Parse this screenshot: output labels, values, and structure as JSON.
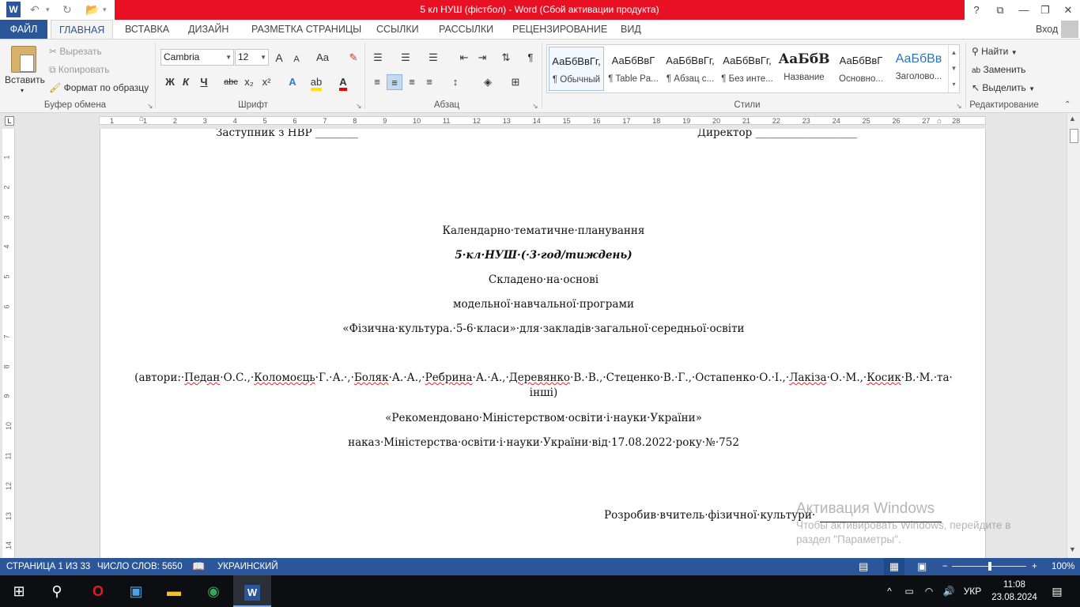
{
  "window": {
    "title": "5 кл НУШ (фістбол) -  Word (Сбой активации продукта)",
    "controls": {
      "help": "?",
      "ribbon_options": "⧉",
      "minimize": "—",
      "restore": "❐",
      "close": "✕"
    }
  },
  "qat": {
    "word_icon": "W",
    "undo": "↶",
    "redo": "↻",
    "open": "📂"
  },
  "tabs": [
    "ФАЙЛ",
    "ГЛАВНАЯ",
    "ВСТАВКА",
    "ДИЗАЙН",
    "РАЗМЕТКА СТРАНИЦЫ",
    "ССЫЛКИ",
    "РАССЫЛКИ",
    "РЕЦЕНЗИРОВАНИЕ",
    "ВИД"
  ],
  "signin": "Вход",
  "ribbon": {
    "clipboard": {
      "paste": "Вставить",
      "cut": "Вырезать",
      "copy": "Копировать",
      "format_painter": "Формат по образцу",
      "label": "Буфер обмена"
    },
    "font": {
      "font_name": "Cambria",
      "font_size": "12",
      "grow": "A",
      "shrink": "A",
      "case": "Aa",
      "bold": "Ж",
      "italic": "К",
      "underline": "Ч",
      "strike": "abc",
      "subscript": "x₂",
      "superscript": "x²",
      "label": "Шрифт"
    },
    "paragraph": {
      "label": "Абзац"
    },
    "styles": {
      "items": [
        {
          "sample": "АаБбВвГг,",
          "name": "¶ Обычный"
        },
        {
          "sample": "АаБбВвГ",
          "name": "¶ Table Pa..."
        },
        {
          "sample": "АаБбВвГг,",
          "name": "¶ Абзац с..."
        },
        {
          "sample": "АаБбВвГг,",
          "name": "¶ Без инте..."
        },
        {
          "sample": "АаБбВ",
          "name": "Название"
        },
        {
          "sample": "АаБбВвГ",
          "name": "Основно..."
        },
        {
          "sample": "АаБбВв",
          "name": "Заголово..."
        }
      ],
      "label": "Стили"
    },
    "editing": {
      "find": "Найти",
      "replace": "Заменить",
      "select": "Выделить",
      "label": "Редактирование"
    }
  },
  "ruler": {
    "numbers": [
      "1",
      "1",
      "2",
      "3",
      "4",
      "5",
      "6",
      "7",
      "8",
      "9",
      "10",
      "11",
      "12",
      "13",
      "14",
      "15",
      "16",
      "17",
      "18",
      "19",
      "20",
      "21",
      "22",
      "23",
      "24",
      "25",
      "26",
      "27",
      "28"
    ],
    "vnumbers": [
      "1",
      "2",
      "3",
      "4",
      "5",
      "6",
      "7",
      "8",
      "9",
      "10",
      "11",
      "12",
      "13",
      "14",
      "15"
    ]
  },
  "document": {
    "top_left": "Заступник з НВР ________",
    "top_right": "Директор ___________________",
    "title": "Календарно·тематичне·планування",
    "subtitle": "5·кл·НУШ·(·3·год/тиждень)",
    "line1": "Складено·на·основі",
    "line2": "модельної·навчальної·програми",
    "line3": "«Фізична·культура.·5-6·класи»·для·закладів·загальної·середньої·освіти",
    "authors_1": "(автори:·Педан·О.С.,·Коломоєць·Г.·А.·,·Боляк·А.·А.,·Ребрина·А.·А.,·Деревянко·В.·В.,·Стеценко·В.·Г.,·Остапенко·О.·І.,·Лакіза·О.·М.,·Косик·В.·М.·та·",
    "authors_2": "інші)",
    "recommended": "«Рекомендовано·Міністерством·освіти·і·науки·України»",
    "order": "наказ·Міністерства·освіти·і·науки·України·від·17.08.2022·року·№·752",
    "developer": "Розробив·вчитель·фізичної·культури·"
  },
  "activation": {
    "title": "Активация Windows",
    "line1": "Чтобы активировать Windows, перейдите в",
    "line2": "раздел \"Параметры\"."
  },
  "status": {
    "page": "СТРАНИЦА 1 ИЗ 33",
    "words": "ЧИСЛО СЛОВ: 5650",
    "language": "УКРАИНСКИЙ",
    "zoom": "100%"
  },
  "taskbar": {
    "lang": "УКР",
    "time": "11:08",
    "date": "23.08.2024"
  }
}
